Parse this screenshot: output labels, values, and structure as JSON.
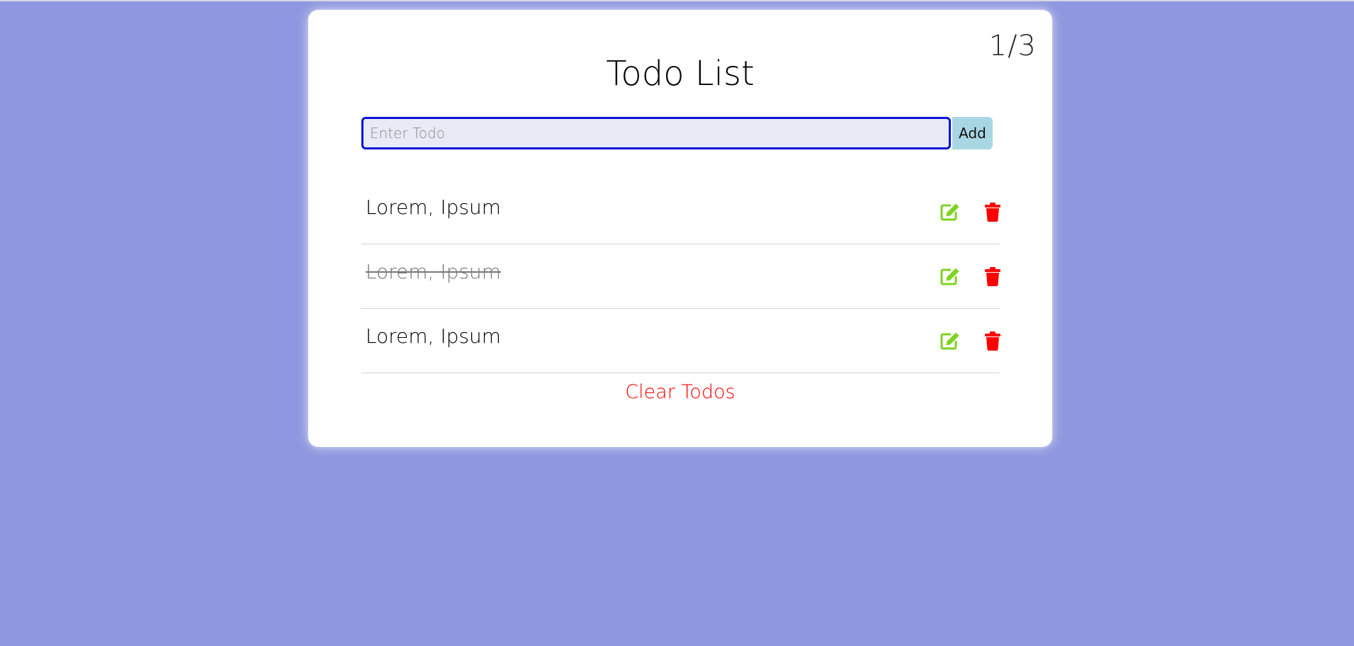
{
  "header": {
    "counter": "1/3",
    "title": "Todo List"
  },
  "form": {
    "placeholder": "Enter Todo",
    "value": "",
    "add_label": "Add"
  },
  "todos": [
    {
      "text": "Lorem, Ipsum",
      "completed": false
    },
    {
      "text": "Lorem, Ipsum",
      "completed": true
    },
    {
      "text": "Lorem, Ipsum",
      "completed": false
    }
  ],
  "footer": {
    "clear_label": "Clear Todos"
  },
  "colors": {
    "background": "#8e97df",
    "edit_icon": "#7ed321",
    "delete_icon": "#ff0000",
    "input_border": "#0a12d8",
    "add_button": "#a9d6e3",
    "clear_text": "#ff0000"
  },
  "icons": {
    "edit": "edit-icon",
    "delete": "trash-icon"
  }
}
